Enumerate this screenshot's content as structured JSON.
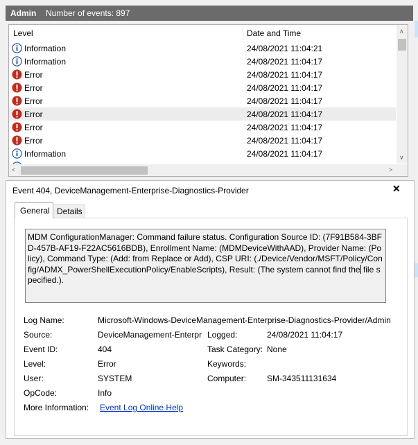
{
  "header": {
    "title": "Admin",
    "count": "Number of events: 897"
  },
  "list": {
    "columns": {
      "level": "Level",
      "datetime": "Date and Time"
    },
    "rows": [
      {
        "level": "Information",
        "datetime": "24/08/2021 11:04:21",
        "icon": "info-icon"
      },
      {
        "level": "Information",
        "datetime": "24/08/2021 11:04:17",
        "icon": "info-icon"
      },
      {
        "level": "Error",
        "datetime": "24/08/2021 11:04:17",
        "icon": "error-icon"
      },
      {
        "level": "Error",
        "datetime": "24/08/2021 11:04:17",
        "icon": "error-icon"
      },
      {
        "level": "Error",
        "datetime": "24/08/2021 11:04:17",
        "icon": "error-icon"
      },
      {
        "level": "Error",
        "datetime": "24/08/2021 11:04:17",
        "icon": "error-icon",
        "selected": true
      },
      {
        "level": "Error",
        "datetime": "24/08/2021 11:04:17",
        "icon": "error-icon"
      },
      {
        "level": "Error",
        "datetime": "24/08/2021 11:04:17",
        "icon": "error-icon"
      },
      {
        "level": "Information",
        "datetime": "24/08/2021 11:04:17",
        "icon": "info-icon"
      }
    ]
  },
  "detail": {
    "title": "Event 404, DeviceManagement-Enterprise-Diagnostics-Provider",
    "tabs": {
      "general": "General",
      "details": "Details"
    },
    "message_before_caret": "MDM ConfigurationManager: Command failure status. Configuration Source ID: (7F91B584-3BFD-457B-AF19-F22AC5616BDB), Enrollment Name: (MDMDeviceWithAAD), Provider Name: (Policy), Command Type: (Add: from Replace or Add), CSP URI: (./Device/Vendor/MSFT/Policy/Config/ADMX_PowerShellExecutionPolicy/EnableScripts), Result: (The system cannot find the",
    "message_after_caret": " file specified.).",
    "fields": {
      "log_name_label": "Log Name:",
      "log_name": "Microsoft-Windows-DeviceManagement-Enterprise-Diagnostics-Provider/Admin",
      "source_label": "Source:",
      "source": "DeviceManagement-Enterprise-Diagnostics-Provider",
      "logged_label": "Logged:",
      "logged": "24/08/2021 11:04:17",
      "event_id_label": "Event ID:",
      "event_id": "404",
      "task_category_label": "Task Category:",
      "task_category": "None",
      "level_label": "Level:",
      "level": "Error",
      "keywords_label": "Keywords:",
      "user_label": "User:",
      "user": "SYSTEM",
      "computer_label": "Computer:",
      "computer": "SM-343511131634",
      "opcode_label": "OpCode:",
      "opcode": "Info",
      "more_info_label": "More Information:",
      "more_info_link": "Event Log Online Help"
    }
  },
  "colors": {
    "header_bg": "#6b6b6b",
    "error": "#c42b1c",
    "info": "#2a5db0",
    "link": "#0033cc"
  }
}
